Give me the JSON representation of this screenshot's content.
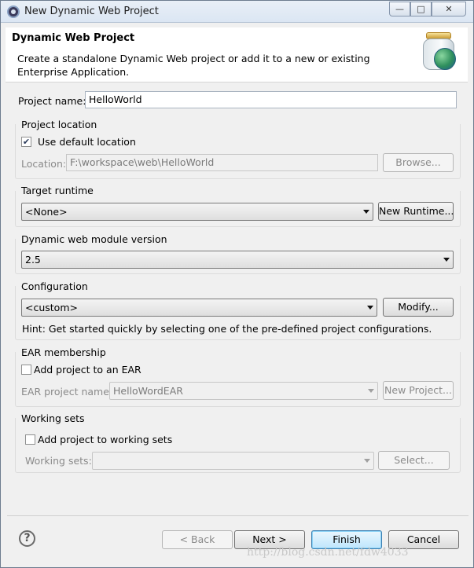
{
  "window": {
    "title": "New Dynamic Web Project",
    "controls": {
      "minimize": "—",
      "maximize": "□",
      "close": "✕"
    }
  },
  "header": {
    "title": "Dynamic Web Project",
    "description": "Create a standalone Dynamic Web project or add it to a new or existing Enterprise Application.",
    "icon": "jar-globe-icon"
  },
  "project_name": {
    "label": "Project name:",
    "value": "HelloWorld"
  },
  "project_location": {
    "group_title": "Project location",
    "use_default_label": "Use default location",
    "use_default_checked": true,
    "location_label": "Location:",
    "location_value": "F:\\workspace\\web\\HelloWorld",
    "browse_label": "Browse..."
  },
  "target_runtime": {
    "group_title": "Target runtime",
    "selected": "<None>",
    "new_runtime_label": "New Runtime..."
  },
  "module_version": {
    "group_title": "Dynamic web module version",
    "selected": "2.5"
  },
  "configuration": {
    "group_title": "Configuration",
    "selected": "<custom>",
    "modify_label": "Modify...",
    "hint": "Hint: Get started quickly by selecting one of the pre-defined project configurations."
  },
  "ear": {
    "group_title": "EAR membership",
    "add_label": "Add project to an EAR",
    "add_checked": false,
    "ear_name_label": "EAR project name:",
    "ear_name_value": "HelloWordEAR",
    "new_project_label": "New Project..."
  },
  "working_sets": {
    "group_title": "Working sets",
    "add_label": "Add project to working sets",
    "add_checked": false,
    "sets_label": "Working sets:",
    "sets_value": "",
    "select_label": "Select..."
  },
  "footer": {
    "back_label": "< Back",
    "next_label": "Next >",
    "finish_label": "Finish",
    "cancel_label": "Cancel",
    "help_glyph": "?"
  },
  "watermark": "http://blog.csdn.net/fdw4033"
}
